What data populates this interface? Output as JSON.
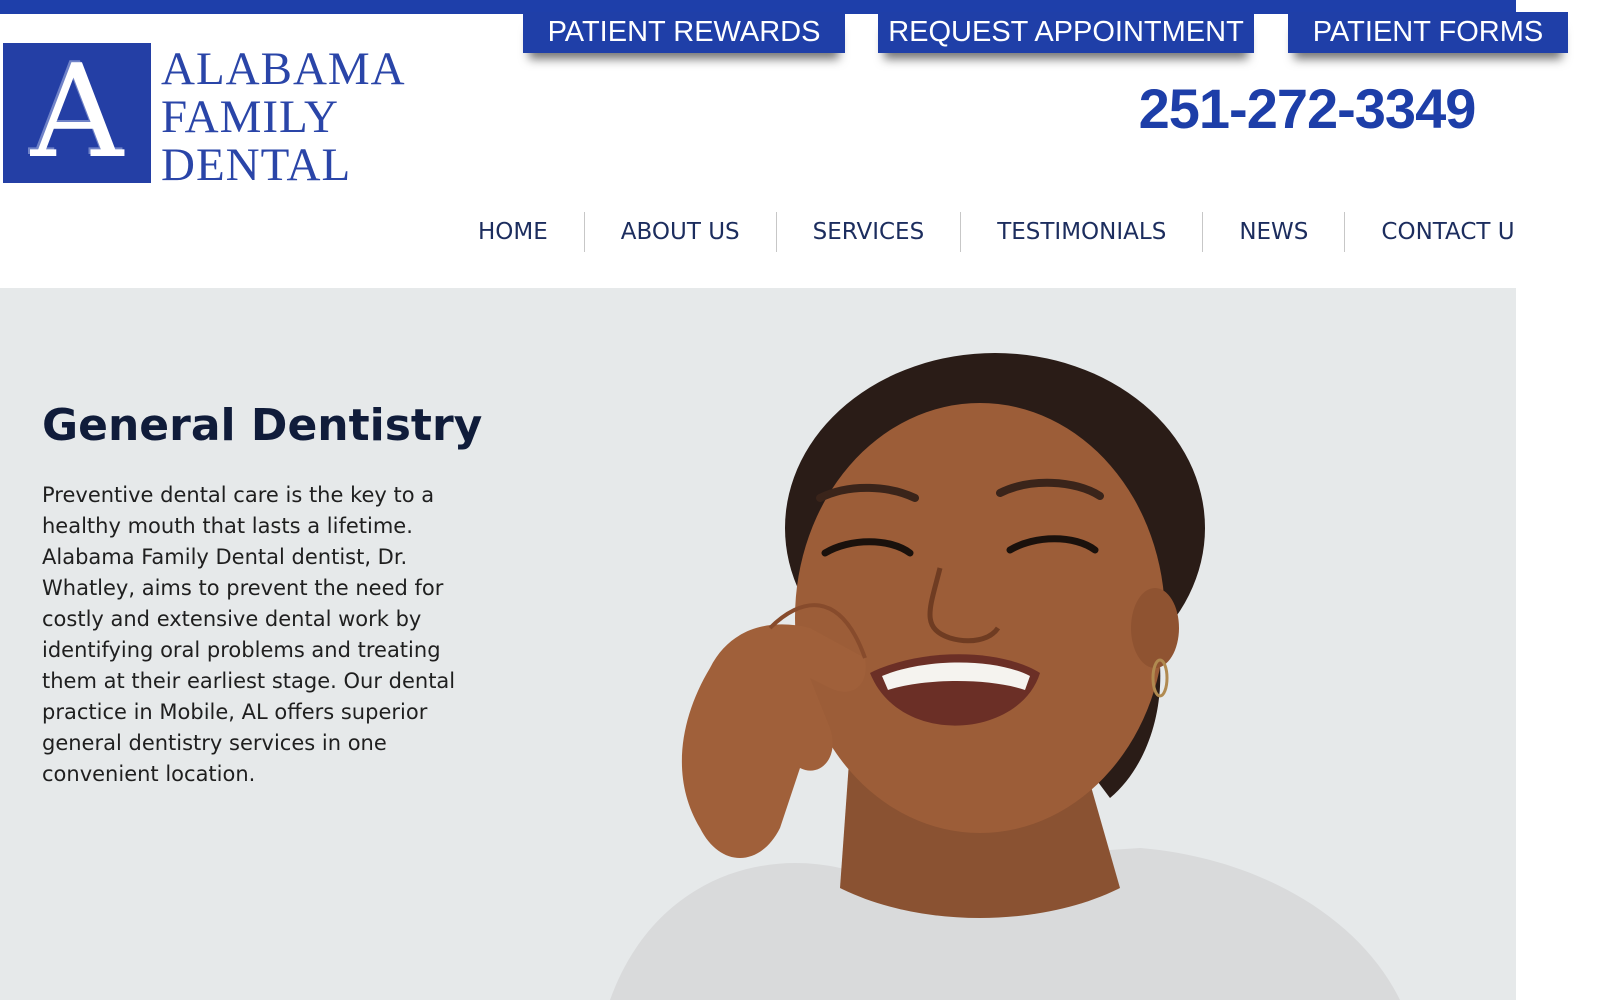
{
  "header": {
    "logo": {
      "letter": "A",
      "lines": [
        "ALABAMA",
        "FAMILY",
        "DENTAL"
      ]
    },
    "buttons": {
      "rewards": "PATIENT REWARDS",
      "appointment": "REQUEST APPOINTMENT",
      "forms": "PATIENT FORMS"
    },
    "phone": "251-272-3349"
  },
  "nav": {
    "items": [
      "HOME",
      "ABOUT US",
      "SERVICES",
      "TESTIMONIALS",
      "NEWS",
      "CONTACT US"
    ]
  },
  "hero": {
    "title": "General Dentistry",
    "body": "Preventive dental care is the key to a healthy mouth that lasts a lifetime. Alabama Family Dental dentist, Dr. Whatley, aims to prevent the need for costly and extensive dental work by identifying oral problems and treating them at their earliest stage. Our dental practice in Mobile, AL offers superior general dentistry services in one convenient location."
  },
  "colors": {
    "brand_blue": "#1f3fa8",
    "nav_text": "#1c2d5e",
    "hero_bg": "#e6e9ea"
  }
}
